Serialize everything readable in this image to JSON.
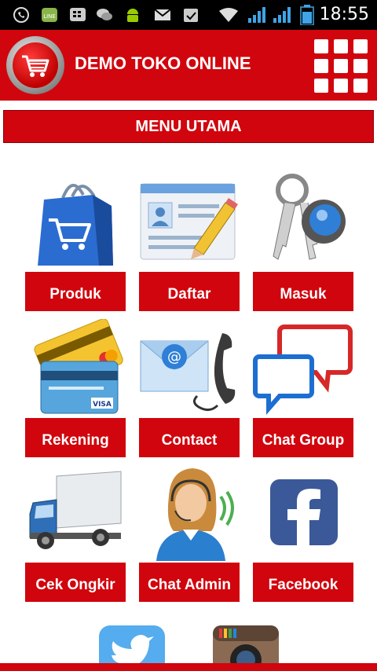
{
  "status_bar": {
    "time": "18:55",
    "icons": [
      "whatsapp-icon",
      "line-icon",
      "bbm-icon",
      "chat-bubbles-icon",
      "android-icon",
      "mail-icon",
      "clipboard-icon",
      "wifi-icon",
      "signal-icon",
      "signal-icon",
      "battery-icon"
    ]
  },
  "app": {
    "title": "DEMO TOKO ONLINE",
    "logo_icon": "shopping-cart-icon",
    "menu_icon": "grid-menu-icon",
    "accent_color": "#d1050d"
  },
  "menu": {
    "title": "MENU UTAMA",
    "items": [
      {
        "label": "Produk",
        "icon": "shopping-bag-icon"
      },
      {
        "label": "Daftar",
        "icon": "registration-form-icon"
      },
      {
        "label": "Masuk",
        "icon": "keys-icon"
      },
      {
        "label": "Rekening",
        "icon": "credit-card-icon"
      },
      {
        "label": "Contact",
        "icon": "email-phone-icon"
      },
      {
        "label": "Chat Group",
        "icon": "speech-bubbles-icon"
      },
      {
        "label": "Cek Ongkir",
        "icon": "delivery-truck-icon"
      },
      {
        "label": "Chat Admin",
        "icon": "customer-service-icon"
      },
      {
        "label": "Facebook",
        "icon": "facebook-icon"
      },
      {
        "label": "",
        "icon": "twitter-icon"
      },
      {
        "label": "",
        "icon": "instagram-icon"
      }
    ]
  }
}
